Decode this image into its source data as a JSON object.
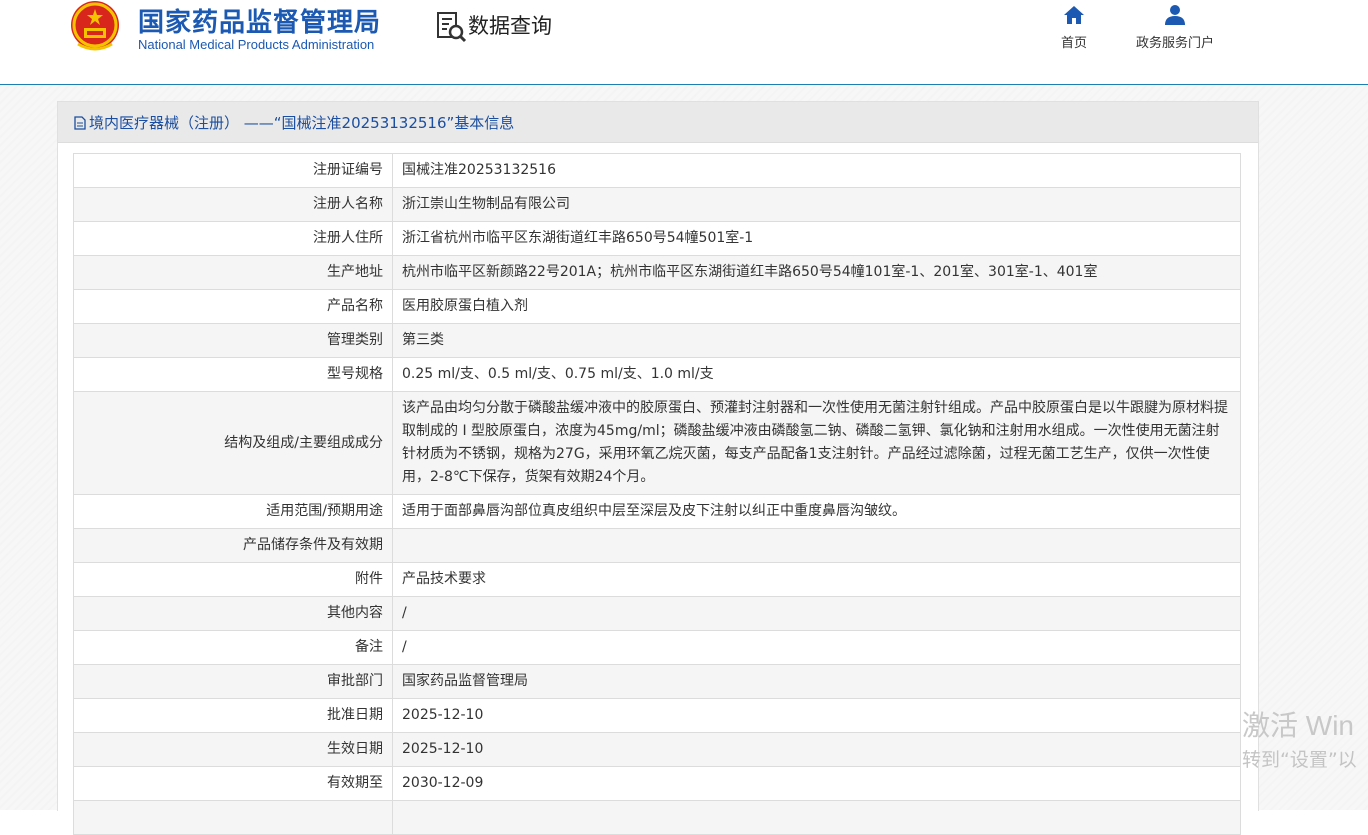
{
  "header": {
    "brand_cn": "国家药品监督管理局",
    "brand_en": "National Medical Products Administration",
    "query_title": "数据查询",
    "nav": [
      {
        "label": "首页",
        "icon": "home-icon"
      },
      {
        "label": "政务服务门户",
        "icon": "user-icon"
      }
    ],
    "accent_color": "#1b59b2"
  },
  "panel": {
    "title": "境内医疗器械（注册） ——“国械注准20253132516”基本信息"
  },
  "rows": [
    {
      "label": "注册证编号",
      "value": "国械注准20253132516"
    },
    {
      "label": "注册人名称",
      "value": "浙江崇山生物制品有限公司"
    },
    {
      "label": "注册人住所",
      "value": "浙江省杭州市临平区东湖街道红丰路650号54幢501室-1"
    },
    {
      "label": "生产地址",
      "value": "杭州市临平区新颜路22号201A；杭州市临平区东湖街道红丰路650号54幢101室-1、201室、301室-1、401室"
    },
    {
      "label": "产品名称",
      "value": "医用胶原蛋白植入剂"
    },
    {
      "label": "管理类别",
      "value": "第三类"
    },
    {
      "label": "型号规格",
      "value": "0.25 ml/支、0.5 ml/支、0.75 ml/支、1.0 ml/支"
    },
    {
      "label": "结构及组成/主要组成成分",
      "value": "该产品由均匀分散于磷酸盐缓冲液中的胶原蛋白、预灌封注射器和一次性使用无菌注射针组成。产品中胶原蛋白是以牛跟腱为原材料提取制成的 I 型胶原蛋白，浓度为45mg/ml；磷酸盐缓冲液由磷酸氢二钠、磷酸二氢钾、氯化钠和注射用水组成。一次性使用无菌注射针材质为不锈钢，规格为27G，采用环氧乙烷灭菌，每支产品配备1支注射针。产品经过滤除菌，过程无菌工艺生产，仅供一次性使用，2-8℃下保存，货架有效期24个月。"
    },
    {
      "label": "适用范围/预期用途",
      "value": "适用于面部鼻唇沟部位真皮组织中层至深层及皮下注射以纠正中重度鼻唇沟皱纹。"
    },
    {
      "label": "产品储存条件及有效期",
      "value": ""
    },
    {
      "label": "附件",
      "value": "产品技术要求"
    },
    {
      "label": "其他内容",
      "value": "/"
    },
    {
      "label": "备注",
      "value": "/"
    },
    {
      "label": "审批部门",
      "value": "国家药品监督管理局"
    },
    {
      "label": "批准日期",
      "value": "2025-12-10"
    },
    {
      "label": "生效日期",
      "value": "2025-12-10"
    },
    {
      "label": "有效期至",
      "value": "2030-12-09"
    },
    {
      "label": "",
      "value": ""
    }
  ],
  "watermark": {
    "line1": "激活 Win",
    "line2": "转到“设置”以"
  }
}
